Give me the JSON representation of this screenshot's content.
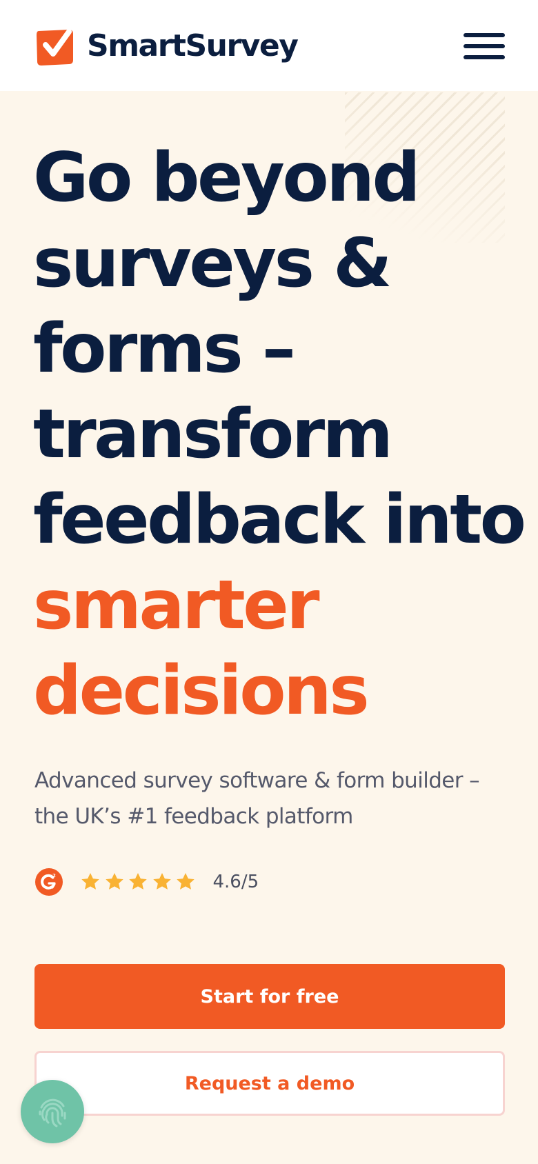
{
  "header": {
    "brand": "SmartSurvey",
    "menu_icon": "hamburger-menu-icon"
  },
  "hero": {
    "headline_lines": [
      "Go beyond",
      "surveys &",
      "forms –",
      "transform",
      "feedback into"
    ],
    "headline_accent_lines": [
      "smarter",
      "decisions"
    ],
    "subtitle_lines": [
      "Advanced survey software & form builder –",
      "the UK’s #1 feedback platform"
    ]
  },
  "rating": {
    "badge_icon": "g2-logo-icon",
    "star_count": 5,
    "value": "4.6/5"
  },
  "cta": {
    "primary_label": "Start for free",
    "secondary_label": "Request a demo"
  },
  "floating_button": {
    "icon": "fingerprint-icon"
  },
  "colors": {
    "navy": "#0B1E3F",
    "accent": "#F15A24",
    "background": "#FDF6EB",
    "star": "#F9B233",
    "fab": "#6FC3A7"
  }
}
